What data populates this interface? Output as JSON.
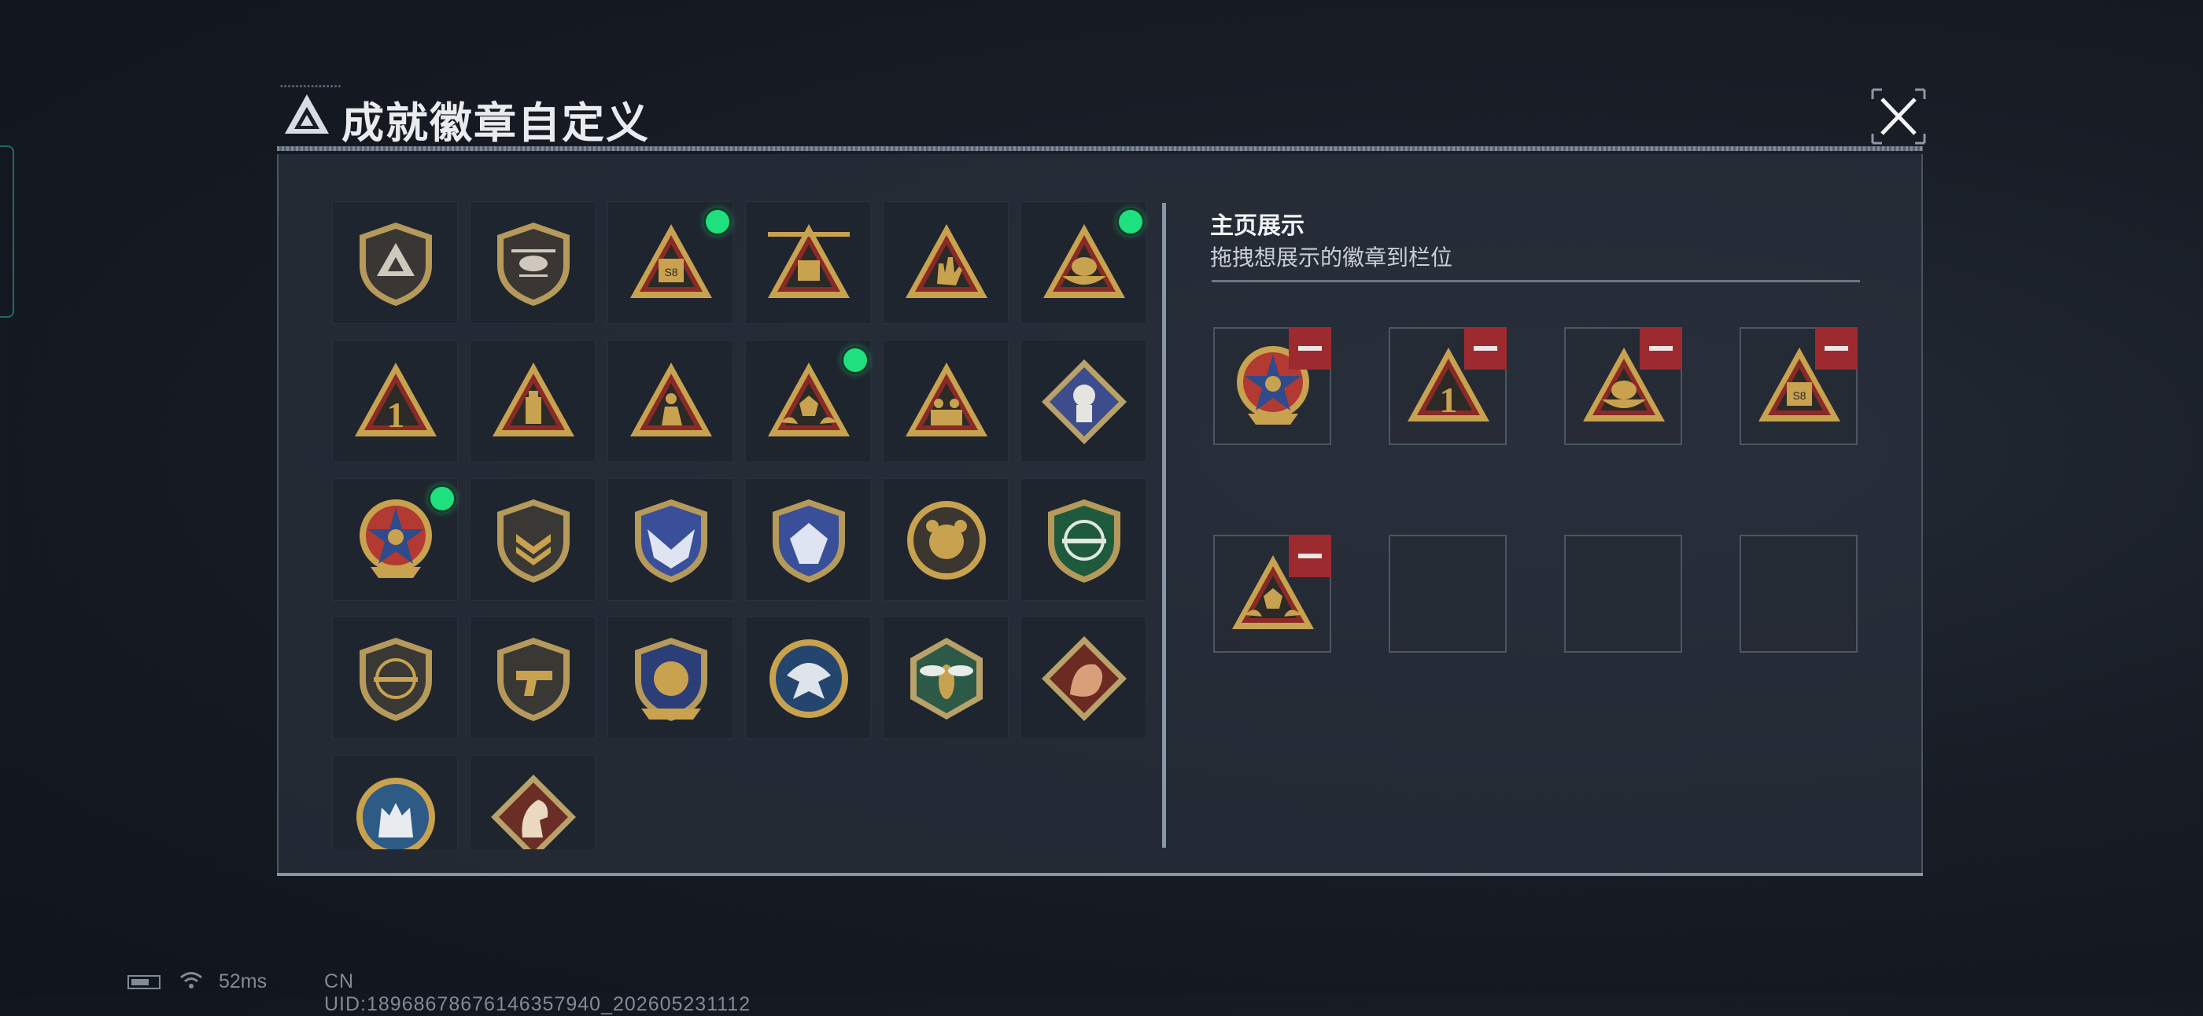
{
  "header": {
    "title": "成就徽章自定义",
    "close_label": "✕"
  },
  "inventory": {
    "badges": [
      {
        "name": "delta-shield-icon",
        "new": false
      },
      {
        "name": "helicopter-shield-icon",
        "new": false
      },
      {
        "name": "s8-triangle-icon",
        "new": true
      },
      {
        "name": "winged-s8-triangle-icon",
        "new": false
      },
      {
        "name": "hand-gesture-triangle-icon",
        "new": false
      },
      {
        "name": "egg-nest-triangle-icon",
        "new": true
      },
      {
        "name": "number-one-triangle-icon",
        "new": false
      },
      {
        "name": "usb-triangle-icon",
        "new": false
      },
      {
        "name": "soldier-triangle-icon",
        "new": false
      },
      {
        "name": "hands-dice-triangle-icon",
        "new": true
      },
      {
        "name": "squad-triangle-icon",
        "new": false
      },
      {
        "name": "rose-fist-diamond-icon",
        "new": false
      },
      {
        "name": "star-skull-medal-icon",
        "new": true
      },
      {
        "name": "chevron-shield-icon",
        "new": false
      },
      {
        "name": "blue-wing-crest-icon",
        "new": false
      },
      {
        "name": "blue-gem-crest-icon",
        "new": false
      },
      {
        "name": "bear-round-icon",
        "new": false
      },
      {
        "name": "green-rifle-shield-icon",
        "new": false
      },
      {
        "name": "rifle-crosshair-shield-icon",
        "new": false
      },
      {
        "name": "pistol-shield-icon",
        "new": false
      },
      {
        "name": "gold-blue-crest-icon",
        "new": false
      },
      {
        "name": "eagle-round-icon",
        "new": false
      },
      {
        "name": "wasp-hexagon-icon",
        "new": false
      },
      {
        "name": "dragon-diamond-icon",
        "new": false
      },
      {
        "name": "wolf-round-icon",
        "new": false
      },
      {
        "name": "horse-diamond-icon",
        "new": false
      }
    ]
  },
  "showcase": {
    "title": "主页展示",
    "subtitle": "拖拽想展示的徽章到栏位",
    "slots": [
      {
        "badge": "star-skull-medal-icon",
        "filled": true
      },
      {
        "badge": "number-one-triangle-icon",
        "filled": true
      },
      {
        "badge": "egg-nest-triangle-icon",
        "filled": true
      },
      {
        "badge": "s8-triangle-icon",
        "filled": true
      },
      {
        "badge": "hands-dice-triangle-icon",
        "filled": true
      },
      {
        "badge": "",
        "filled": false
      },
      {
        "badge": "",
        "filled": false
      },
      {
        "badge": "",
        "filled": false
      }
    ]
  },
  "status": {
    "ping": "52ms",
    "uid": "CN UID:18968678676146357940_202605231112"
  },
  "colors": {
    "gold": "#c8a24f",
    "badge_red": "#8a2a26",
    "new_dot": "#1fe07f",
    "remove_red": "#9c2a2f"
  }
}
